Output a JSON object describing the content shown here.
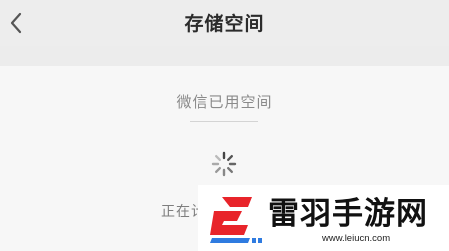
{
  "header": {
    "back_icon": "chevron-left-icon",
    "title": "存储空间"
  },
  "storage": {
    "used_label": "微信已用空间",
    "loading_icon": "loading-spinner-icon",
    "calculating_text": "正在计算..."
  },
  "watermark": {
    "name": "雷羽手游网",
    "url": "www.leiucn.com",
    "colors": {
      "red": "#e8242a",
      "blue": "#2f7be0"
    }
  }
}
